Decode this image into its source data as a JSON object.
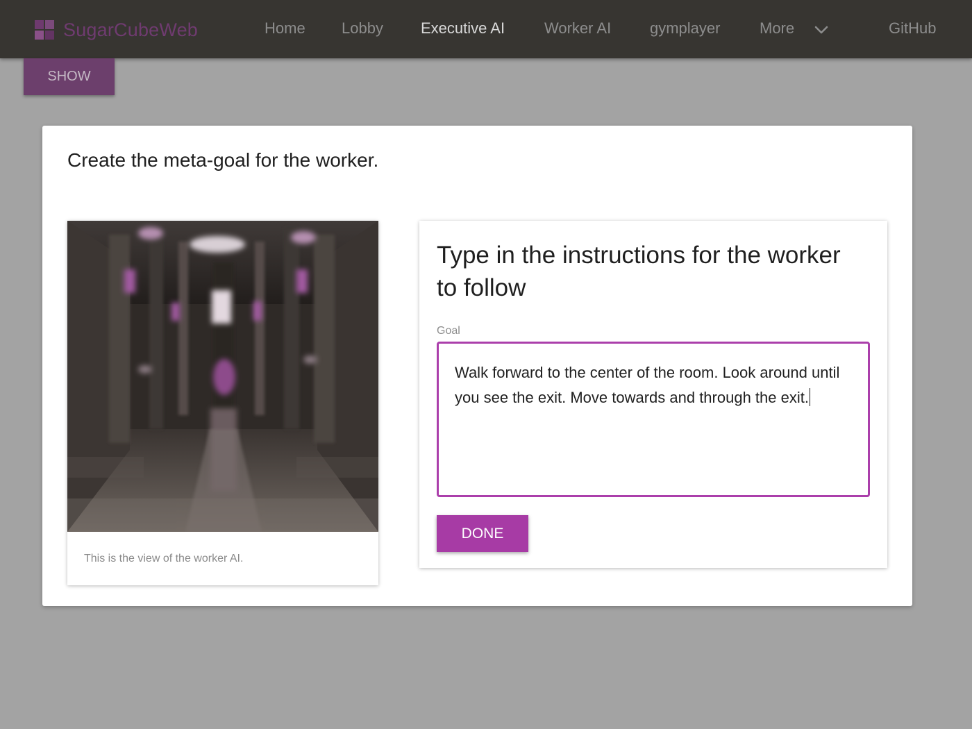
{
  "navbar": {
    "brand": "SugarCubeWeb",
    "links": [
      {
        "label": "Home"
      },
      {
        "label": "Lobby"
      },
      {
        "label": "Executive AI",
        "active": true
      },
      {
        "label": "Worker AI"
      },
      {
        "label": "gymplayer"
      },
      {
        "label": "More"
      },
      {
        "label": "GitHub"
      }
    ],
    "more_icon": "chevron-down-icon",
    "brand_icon": "grid-logo-icon"
  },
  "show_button": {
    "label": "SHOW"
  },
  "main": {
    "title": "Create the meta-goal for the worker.",
    "image_card": {
      "caption": "This is the view of the worker AI."
    },
    "instructions_card": {
      "title": "Type in the instructions for the worker to follow",
      "goal_label": "Goal",
      "goal_value": "Walk forward to the center of the room. Look around until you see the exit. Move towards and through the exit.",
      "done_label": "DONE"
    }
  },
  "colors": {
    "accent": "#a73ba5",
    "navbar_bg": "#373531",
    "page_bg": "#a3a3a3"
  }
}
